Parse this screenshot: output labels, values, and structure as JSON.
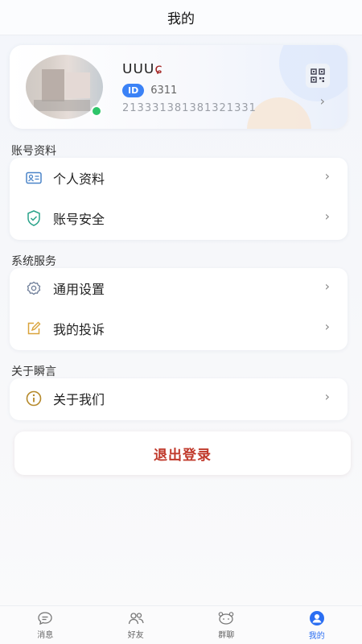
{
  "header": {
    "title": "我的"
  },
  "profile": {
    "nickname_prefix": "ᑌᑌᑌ",
    "nickname_suffix": "ɕ",
    "id_badge": "ID",
    "id_value": "6311",
    "phone": "213331381381321331",
    "online_color": "#2ec56a"
  },
  "sections": {
    "account": {
      "title": "账号资料",
      "items": [
        {
          "label": "个人资料",
          "icon": "id-card-icon"
        },
        {
          "label": "账号安全",
          "icon": "shield-check-icon"
        }
      ]
    },
    "system": {
      "title": "系统服务",
      "items": [
        {
          "label": "通用设置",
          "icon": "gear-icon"
        },
        {
          "label": "我的投诉",
          "icon": "edit-icon"
        }
      ]
    },
    "about": {
      "title": "关于瞬言",
      "items": [
        {
          "label": "关于我们",
          "icon": "info-icon"
        }
      ]
    }
  },
  "logout": {
    "label": "退出登录",
    "color": "#c0392b"
  },
  "tabbar": {
    "active_color": "#2b6ef2",
    "tabs": [
      {
        "label": "消息",
        "icon": "message-icon"
      },
      {
        "label": "好友",
        "icon": "friends-icon"
      },
      {
        "label": "群聊",
        "icon": "group-chat-icon"
      },
      {
        "label": "我的",
        "icon": "profile-icon",
        "active": true
      }
    ]
  }
}
